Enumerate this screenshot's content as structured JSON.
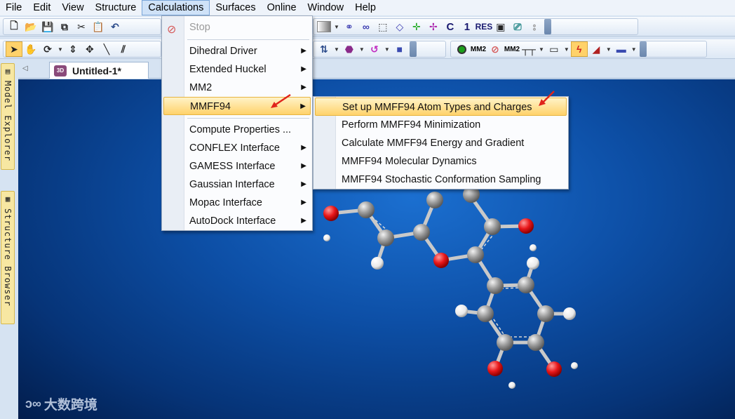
{
  "menubar": {
    "items": [
      {
        "label": "File"
      },
      {
        "label": "Edit"
      },
      {
        "label": "View"
      },
      {
        "label": "Structure"
      },
      {
        "label": "Calculations"
      },
      {
        "label": "Surfaces"
      },
      {
        "label": "Online"
      },
      {
        "label": "Window"
      },
      {
        "label": "Help"
      }
    ]
  },
  "toolbar1": {
    "text_buttons": [
      "C",
      "1",
      "RES"
    ]
  },
  "toolbar2": {
    "text_buttons": [
      "MM2",
      "MM2"
    ]
  },
  "side_panel": {
    "model_explorer": "Model Explorer",
    "structure_browser": "Structure Browser"
  },
  "document": {
    "tab_label": "Untitled-1*",
    "tab_icon_text": "3D"
  },
  "calculations_menu": {
    "stop": "Stop",
    "items": [
      {
        "label": "Dihedral Driver"
      },
      {
        "label": "Extended Huckel"
      },
      {
        "label": "MM2"
      },
      {
        "label": "MMFF94"
      },
      {
        "label": "Compute Properties ..."
      },
      {
        "label": "CONFLEX Interface"
      },
      {
        "label": "GAMESS Interface"
      },
      {
        "label": "Gaussian Interface"
      },
      {
        "label": "Mopac Interface"
      },
      {
        "label": "AutoDock Interface"
      }
    ]
  },
  "mmff94_submenu": {
    "items": [
      {
        "label": "Set up MMFF94 Atom Types and Charges"
      },
      {
        "label": "Perform MMFF94 Minimization"
      },
      {
        "label": "Calculate MMFF94 Energy and Gradient"
      },
      {
        "label": "MMFF94 Molecular Dynamics"
      },
      {
        "label": "MMFF94 Stochastic Conformation Sampling"
      }
    ]
  },
  "watermark": {
    "text": "大数跨境"
  },
  "colors": {
    "highlight": "#ffd26a",
    "viewport_center": "#1b6fd0",
    "viewport_edge": "#021d4c",
    "oxygen": "#e8171a",
    "carbon": "#9a9a9a",
    "hydrogen": "#ffffff",
    "annotation_arrow": "#e0241b"
  }
}
